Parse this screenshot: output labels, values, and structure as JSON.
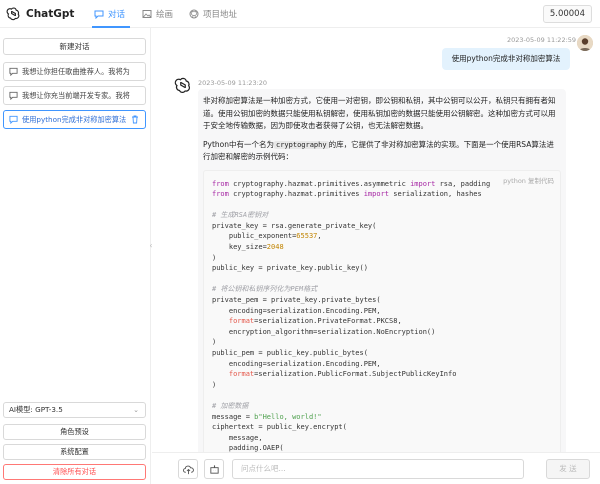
{
  "app": {
    "title": "ChatGpt",
    "version": "5.00004"
  },
  "tabs": [
    {
      "label": "对话",
      "active": true
    },
    {
      "label": "绘画",
      "active": false
    },
    {
      "label": "项目地址",
      "active": false
    }
  ],
  "sidebar": {
    "new_chat": "新建对话",
    "conversations": [
      {
        "label": "我想让你担任歌曲推荐人。我将为"
      },
      {
        "label": "我想让你充当前端开发专家。我将"
      },
      {
        "label": "使用python完成非对称加密算法"
      }
    ],
    "model_label": "AI模型: GPT-3.5",
    "role_preset": "角色预设",
    "system_config": "系统配置",
    "clear_all": "清除所有对话"
  },
  "chat": {
    "user_time": "2023-05-09 11:22:59",
    "user_message": "使用python完成非对称加密算法",
    "ai_time": "2023-05-09 11:23:20",
    "para1": "非对称加密算法是一种加密方式，它使用一对密钥，即公钥和私钥，其中公钥可以公开，私钥只有拥有者知道。使用公钥加密的数据只能使用私钥解密，使用私钥加密的数据只能使用公钥解密。这种加密方式可以用于安全地传输数据，因为即使攻击者获得了公钥，也无法解密数据。",
    "para2_a": "Python中有一个名为",
    "para2_code": "cryptography",
    "para2_b": "的库，它提供了非对称加密算法的实现。下面是一个使用RSA算法进行加密和解密的示例代码：",
    "code_lang": "python",
    "copy_label": "复制代码"
  },
  "input": {
    "placeholder": "问点什么吧...",
    "send_label": "发 送"
  },
  "colors": {
    "accent": "#4096ff",
    "danger": "#ff4d4f",
    "user_bubble": "#e3f2fd"
  }
}
